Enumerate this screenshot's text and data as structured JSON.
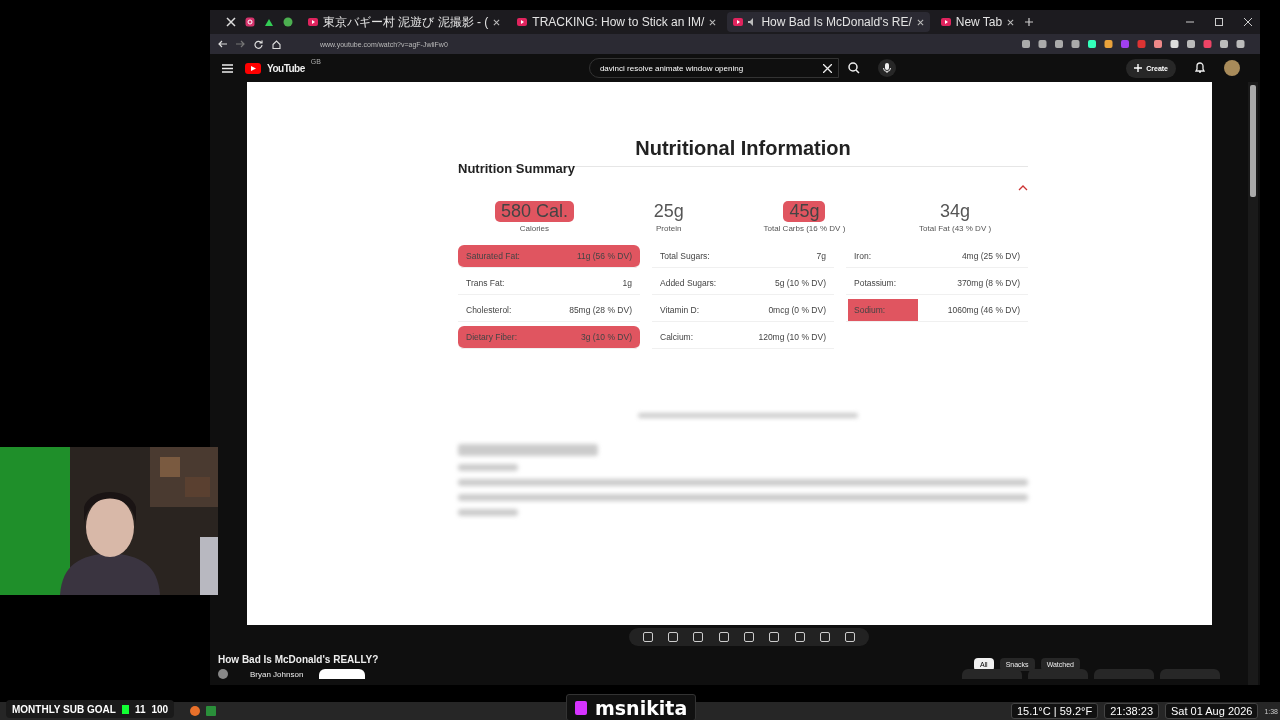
{
  "browser": {
    "tabs": [
      {
        "label": "東京バギー村 泥遊び 泥撮影 - (",
        "selected": false,
        "audio": false
      },
      {
        "label": "TRACKING: How to Stick an IM/",
        "selected": false,
        "audio": false
      },
      {
        "label": "How Bad Is McDonald's RE/",
        "selected": true,
        "audio": true
      },
      {
        "label": "New Tab",
        "selected": false,
        "audio": false
      }
    ],
    "url": "www.youtube.com/watch?v=agF-JwliFw0"
  },
  "youtube": {
    "logo": "YouTube",
    "region": "GB",
    "search": "davinci resolve animate window opening",
    "create": "Create"
  },
  "video": {
    "title": "Nutritional Information",
    "subtitle": "Nutrition Summary",
    "summary": [
      {
        "value": "580 Cal.",
        "label": "Calories",
        "highlighted": true
      },
      {
        "value": "25g",
        "label": "Protein",
        "highlighted": false
      },
      {
        "value": "45g",
        "label": "Total Carbs (16 % DV )",
        "highlighted": true
      },
      {
        "value": "34g",
        "label": "Total Fat (43 % DV )",
        "highlighted": false
      }
    ],
    "columns": [
      [
        {
          "label": "Saturated Fat:",
          "value": "11g (56 % DV)",
          "highlighted": true,
          "label_highlighted": false
        },
        {
          "label": "Trans Fat:",
          "value": "1g",
          "highlighted": false,
          "label_highlighted": false
        },
        {
          "label": "Cholesterol:",
          "value": "85mg (28 % DV)",
          "highlighted": false,
          "label_highlighted": false
        },
        {
          "label": "Dietary Fiber:",
          "value": "3g (10 % DV)",
          "highlighted": true,
          "label_highlighted": false
        }
      ],
      [
        {
          "label": "Total Sugars:",
          "value": "7g",
          "highlighted": false,
          "label_highlighted": false
        },
        {
          "label": "Added Sugars:",
          "value": "5g (10 % DV)",
          "highlighted": false,
          "label_highlighted": false
        },
        {
          "label": "Vitamin D:",
          "value": "0mcg (0 % DV)",
          "highlighted": false,
          "label_highlighted": false
        },
        {
          "label": "Calcium:",
          "value": "120mg (10 % DV)",
          "highlighted": false,
          "label_highlighted": false
        }
      ],
      [
        {
          "label": "Iron:",
          "value": "4mg (25 % DV)",
          "highlighted": false,
          "label_highlighted": false
        },
        {
          "label": "Potassium:",
          "value": "370mg (8 % DV)",
          "highlighted": false,
          "label_highlighted": false
        },
        {
          "label": "Sodium:",
          "value": "1060mg (46 % DV)",
          "highlighted": false,
          "label_highlighted": true
        }
      ]
    ]
  },
  "below_video": {
    "title": "How Bad Is McDonald's REALLY?",
    "channel": "Bryan Johnson",
    "chips": [
      {
        "label": "All",
        "selected": true
      },
      {
        "label": "Snacks",
        "selected": false
      },
      {
        "label": "Watched",
        "selected": false
      }
    ]
  },
  "overlay": {
    "sub_goal": {
      "label": "MONTHLY SUB GOAL",
      "current": "11",
      "target": "100"
    },
    "streamer": "msnikita"
  },
  "taskbar": {
    "weather": "15.1°C | 59.2°F",
    "time": "21:38:23",
    "date": "Sat 01 Aug 2026",
    "clock": "1:38"
  }
}
